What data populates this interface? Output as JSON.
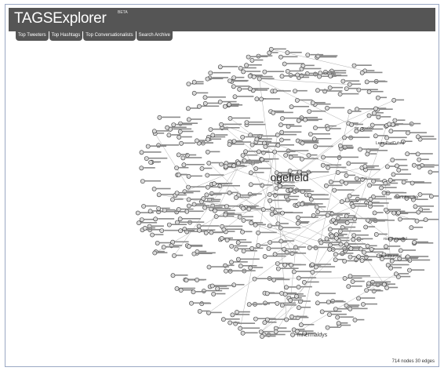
{
  "app": {
    "title": "TAGSExplorer",
    "badge": "BETA"
  },
  "tabs": [
    {
      "label": "Top Tweeters"
    },
    {
      "label": "Top Hashtags"
    },
    {
      "label": "Top Conversationalists"
    },
    {
      "label": "Search Archive"
    }
  ],
  "graph": {
    "center_label": "ogefield",
    "bottom_label": "mnermaldys",
    "node_labels": [
      "charlottes_lab",
      "msindburyed",
      "roaclhaparticl",
      "mr_gradoo",
      "LearnPadCubed"
    ],
    "node_count": 714,
    "edge_count": 30
  },
  "status": {
    "text": "714 nodes 30 edges"
  },
  "colors": {
    "header_bg": "#555555",
    "node_fill": "#d9d9d9",
    "node_stroke": "#333333",
    "edge": "#999999"
  },
  "icons": [
    "node-icon"
  ]
}
